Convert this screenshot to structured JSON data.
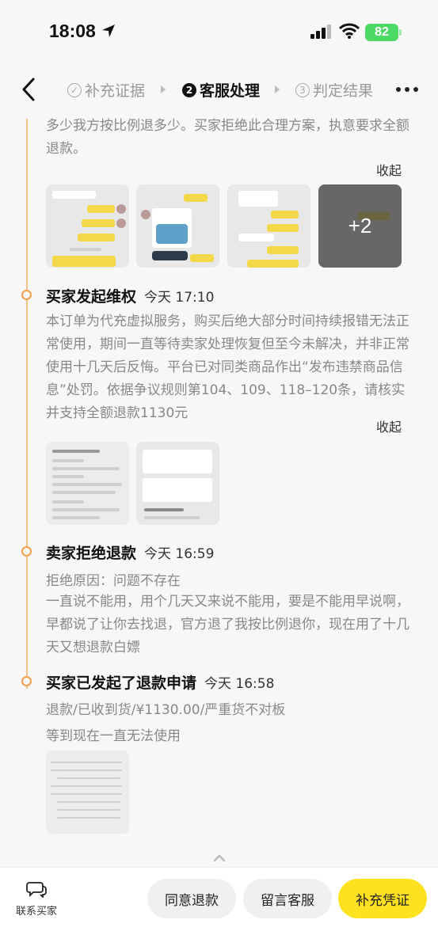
{
  "status": {
    "time": "18:08",
    "battery": "82"
  },
  "nav": {
    "steps": [
      {
        "num": "✓",
        "label": "补充证据"
      },
      {
        "num": "2",
        "label": "客服处理"
      },
      {
        "num": "3",
        "label": "判定结果"
      }
    ]
  },
  "timeline": {
    "top_text": "多少我方按比例退多少。买家拒绝此合理方案，执意要求全额退款。",
    "top_collapse": "收起",
    "top_more": "+2",
    "events": [
      {
        "title": "买家发起维权",
        "time": "今天 17:10",
        "desc": "本订单为代充虚拟服务，购买后绝大部分时间持续报错无法正常使用，期间一直等待卖家处理恢复但至今未解决，并非正常使用十几天后反悔。平台已对同类商品作出“发布违禁商品信息”处罚。依据争议规则第104、109、118–120条，请核实并支持全额退款1130元",
        "collapse": "收起"
      },
      {
        "title": "卖家拒绝退款",
        "time": "今天 16:59",
        "reason": "拒绝原因：问题不存在",
        "desc": "一直说不能用，用个几天又来说不能用，要是不能用早说啊，早都说了让你去找退，官方退了我按比例退你，现在用了十几天又想退款白嫖"
      },
      {
        "title": "买家已发起了退款申请",
        "time": "今天 16:58",
        "detail": "退款/已收到货/¥1130.00/严重货不对板",
        "note": "等到现在一直无法使用"
      }
    ]
  },
  "bottom": {
    "contact": "联系买家",
    "agree": "同意退款",
    "message": "留言客服",
    "supplement": "补充凭证"
  },
  "colors": {
    "accent": "#ffe21f",
    "timeline": "#f5a04a"
  }
}
